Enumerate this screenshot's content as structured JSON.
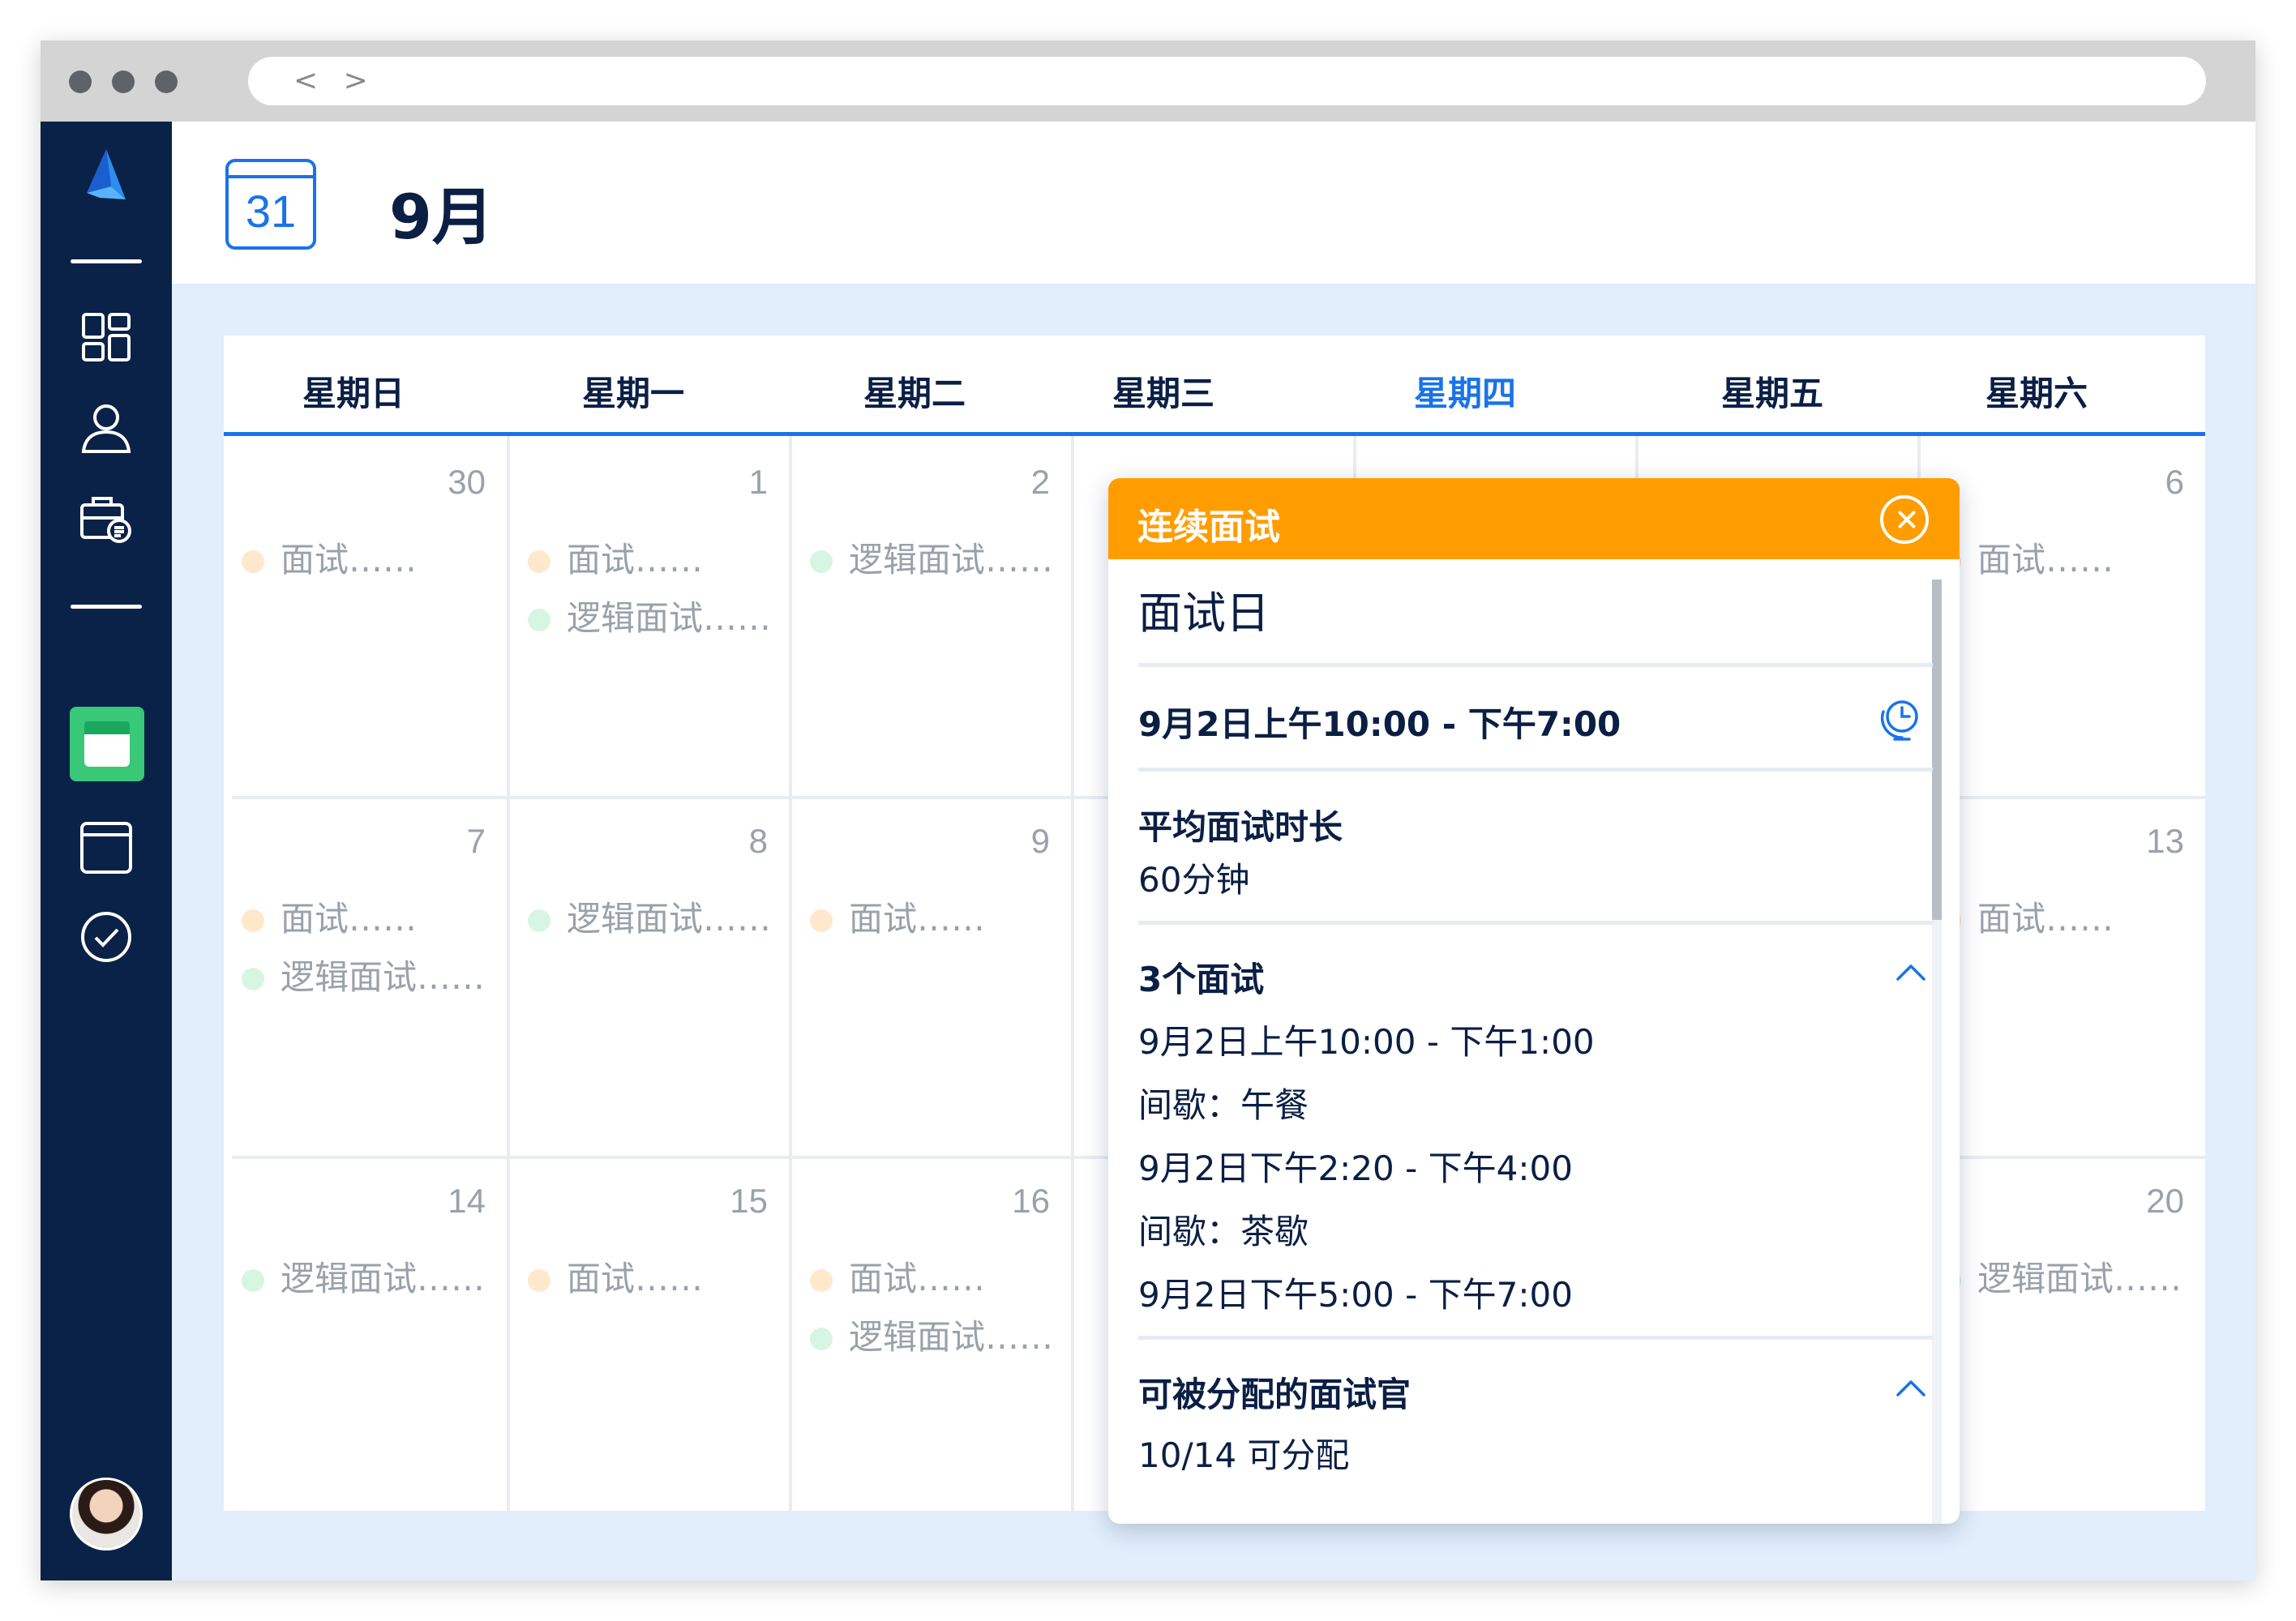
{
  "browser": {
    "nav_glyph": "< >"
  },
  "header": {
    "calendar_icon_day": "31",
    "month": "9月"
  },
  "weekdays": [
    "星期日",
    "星期一",
    "星期二",
    "星期三",
    "星期四",
    "星期五",
    "星期六"
  ],
  "today_weekday": "星期四",
  "weeks": [
    {
      "dates": [
        "30",
        "1",
        "2",
        "",
        "",
        "",
        "6"
      ],
      "events": {
        "sun": [
          {
            "label": "面试……",
            "color": "orange"
          }
        ],
        "mon": [
          {
            "label": "面试……",
            "color": "orange"
          },
          {
            "label": "逻辑面试……",
            "color": "green"
          }
        ],
        "tue": [
          {
            "label": "逻辑面试……",
            "color": "green"
          }
        ],
        "sat": [
          {
            "label": "面试……",
            "color": "orange"
          }
        ]
      }
    },
    {
      "dates": [
        "7",
        "8",
        "9",
        "",
        "",
        "",
        "13"
      ],
      "events": {
        "sun": [
          {
            "label": "面试……",
            "color": "orange"
          },
          {
            "label": "逻辑面试……",
            "color": "green"
          }
        ],
        "mon": [
          {
            "label": "逻辑面试……",
            "color": "green"
          }
        ],
        "tue": [
          {
            "label": "面试……",
            "color": "orange"
          }
        ],
        "sat": [
          {
            "label": "面试……",
            "color": "orange"
          }
        ]
      }
    },
    {
      "dates": [
        "14",
        "15",
        "16",
        "",
        "",
        "",
        "20"
      ],
      "events": {
        "sun": [
          {
            "label": "逻辑面试……",
            "color": "green"
          }
        ],
        "mon": [
          {
            "label": "面试……",
            "color": "orange"
          }
        ],
        "tue": [
          {
            "label": "面试……",
            "color": "orange"
          },
          {
            "label": "逻辑面试……",
            "color": "green"
          }
        ],
        "sat": [
          {
            "label": "逻辑面试……",
            "color": "green"
          }
        ]
      }
    }
  ],
  "popup": {
    "header": "连续面试",
    "title": "面试日",
    "time_range": "9月2日上午10:00 - 下午7:00",
    "avg_duration_label": "平均面试时长",
    "avg_duration_value": "60分钟",
    "interviews_label": "3个面试",
    "schedule": [
      "9月2日上午10:00 - 下午1:00",
      "间歇：午餐",
      "9月2日下午2:20 - 下午4:00",
      "间歇：茶歇",
      "9月2日下午5:00 - 下午7:00"
    ],
    "interviewers_label": "可被分配的面试官",
    "interviewers_value": "10/14 可分配"
  },
  "colors": {
    "sidebar": "#0a2248",
    "accent": "#1a73e8",
    "popup_header": "#ff9d00",
    "active_nav": "#38c878",
    "bullet_orange": "#ffe8cc",
    "bullet_green": "#d6f5e2"
  },
  "icons": {
    "sidebar": [
      "logo-icon",
      "dashboard-icon",
      "user-icon",
      "briefcase-icon",
      "calendar-icon",
      "window-icon",
      "check-circle-icon"
    ],
    "popup": [
      "close-icon",
      "timezone-clock-icon",
      "chevron-up-icon"
    ]
  }
}
